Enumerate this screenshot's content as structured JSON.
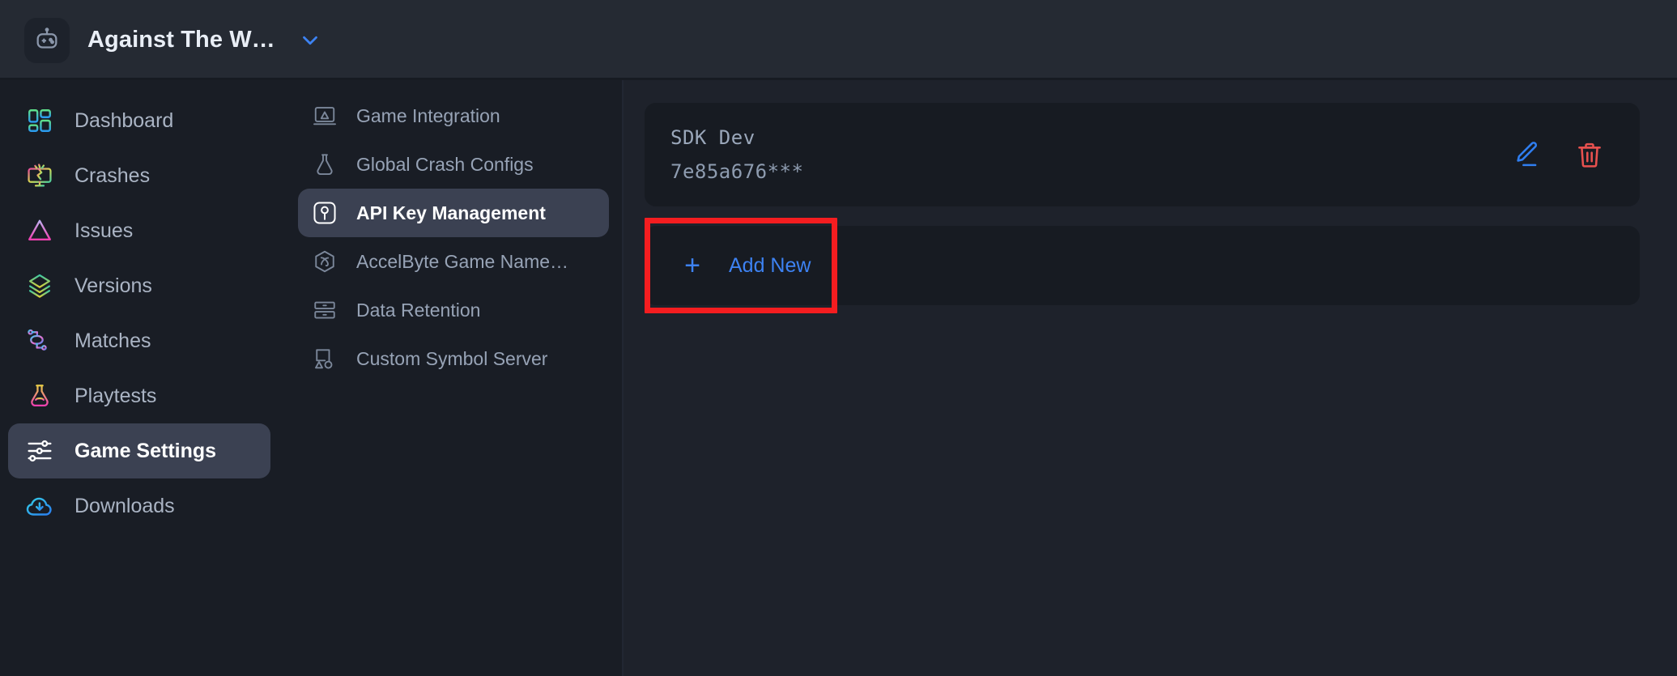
{
  "header": {
    "game_title": "Against The W…",
    "avatar_icon": "game-robot-icon",
    "caret_icon": "chevron-down-icon"
  },
  "sidebar": {
    "items": [
      {
        "label": "Dashboard",
        "icon": "dashboard-grid-icon",
        "active": false
      },
      {
        "label": "Crashes",
        "icon": "crashed-monitor-icon",
        "active": false
      },
      {
        "label": "Issues",
        "icon": "warning-triangle-icon",
        "active": false
      },
      {
        "label": "Versions",
        "icon": "layers-icon",
        "active": false
      },
      {
        "label": "Matches",
        "icon": "match-network-icon",
        "active": false
      },
      {
        "label": "Playtests",
        "icon": "flask-gamepad-icon",
        "active": false
      },
      {
        "label": "Game Settings",
        "icon": "sliders-icon",
        "active": true
      },
      {
        "label": "Downloads",
        "icon": "cloud-download-icon",
        "active": false
      }
    ]
  },
  "subnav": {
    "items": [
      {
        "label": "Game Integration",
        "icon": "game-integration-icon",
        "active": false
      },
      {
        "label": "Global Crash Configs",
        "icon": "flask-icon",
        "active": false
      },
      {
        "label": "API Key Management",
        "icon": "api-key-icon",
        "active": true
      },
      {
        "label": "AccelByte Game Name…",
        "icon": "accelbyte-hex-icon",
        "active": false
      },
      {
        "label": "Data Retention",
        "icon": "database-icon",
        "active": false
      },
      {
        "label": "Custom Symbol Server",
        "icon": "shapes-icon",
        "active": false
      }
    ]
  },
  "main": {
    "api_keys": [
      {
        "name": "SDK  Dev",
        "value": "7e85a676***",
        "edit_icon": "pencil-edit-icon",
        "delete_icon": "trash-delete-icon"
      }
    ],
    "add_new": {
      "label": "Add New",
      "plus": "+",
      "icon": "plus-icon"
    }
  },
  "colors": {
    "accent_blue": "#3d82f2",
    "danger_red": "#e8514f",
    "highlight_red": "#f51d20",
    "active_pill": "#3b4152",
    "card_bg": "#171b22",
    "main_bg": "#1e222b",
    "nav_bg": "#191d25",
    "topbar_bg": "#252a33"
  }
}
